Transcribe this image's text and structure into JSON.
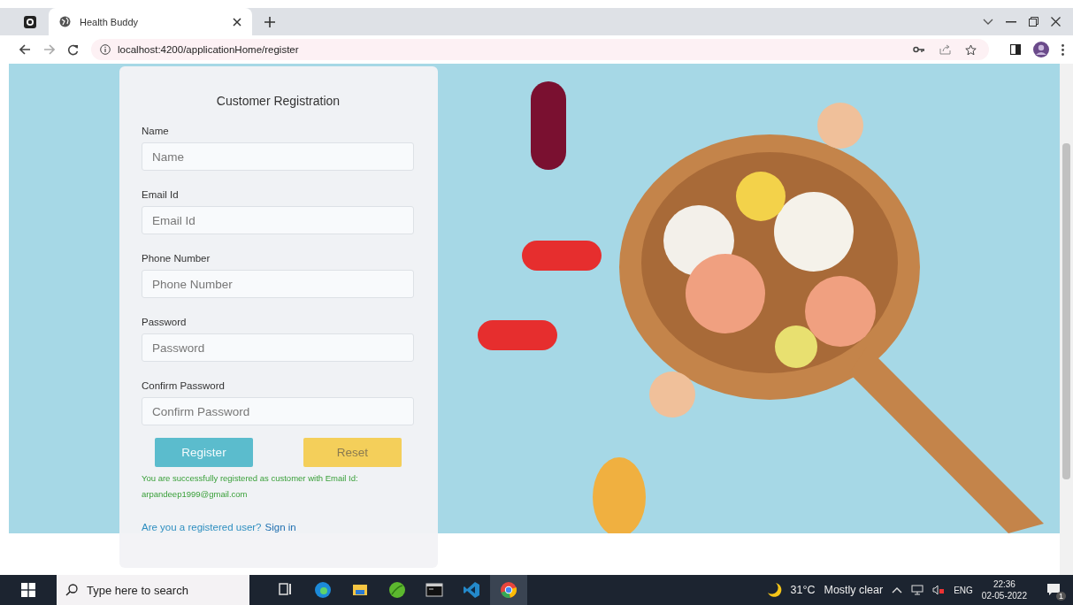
{
  "browser": {
    "tabs": [
      {
        "title": "Health Buddy",
        "selected": true
      }
    ],
    "address": "localhost:4200/applicationHome/register"
  },
  "form": {
    "title": "Customer Registration",
    "fields": [
      {
        "label": "Name",
        "placeholder": "Name"
      },
      {
        "label": "Email Id",
        "placeholder": "Email Id"
      },
      {
        "label": "Phone Number",
        "placeholder": "Phone Number"
      },
      {
        "label": "Password",
        "placeholder": "Password"
      },
      {
        "label": "Confirm Password",
        "placeholder": "Confirm Password"
      }
    ],
    "buttons": [
      {
        "label": "Register",
        "kind": "primary"
      },
      {
        "label": "Reset",
        "kind": "warning"
      }
    ],
    "success_message": "You are successfully registered as customer with Email Id: arpandeep1999@gmail.com",
    "signin_prompt": "Are you a registered user?",
    "signin_link": "Sign in"
  },
  "taskbar": {
    "search_placeholder": "Type here to search",
    "apps": [
      {
        "kind": "taskview",
        "selected": false
      },
      {
        "kind": "edge",
        "selected": false
      },
      {
        "kind": "files",
        "selected": false
      },
      {
        "kind": "leaf",
        "selected": false
      },
      {
        "kind": "terminal",
        "selected": false
      },
      {
        "kind": "code",
        "selected": false
      },
      {
        "kind": "chrome",
        "selected": true
      }
    ],
    "temperature": "31°C",
    "weather": "Mostly clear",
    "language": "ENG",
    "time": "22:36",
    "date": "02-05-2022",
    "notifications": "1"
  }
}
